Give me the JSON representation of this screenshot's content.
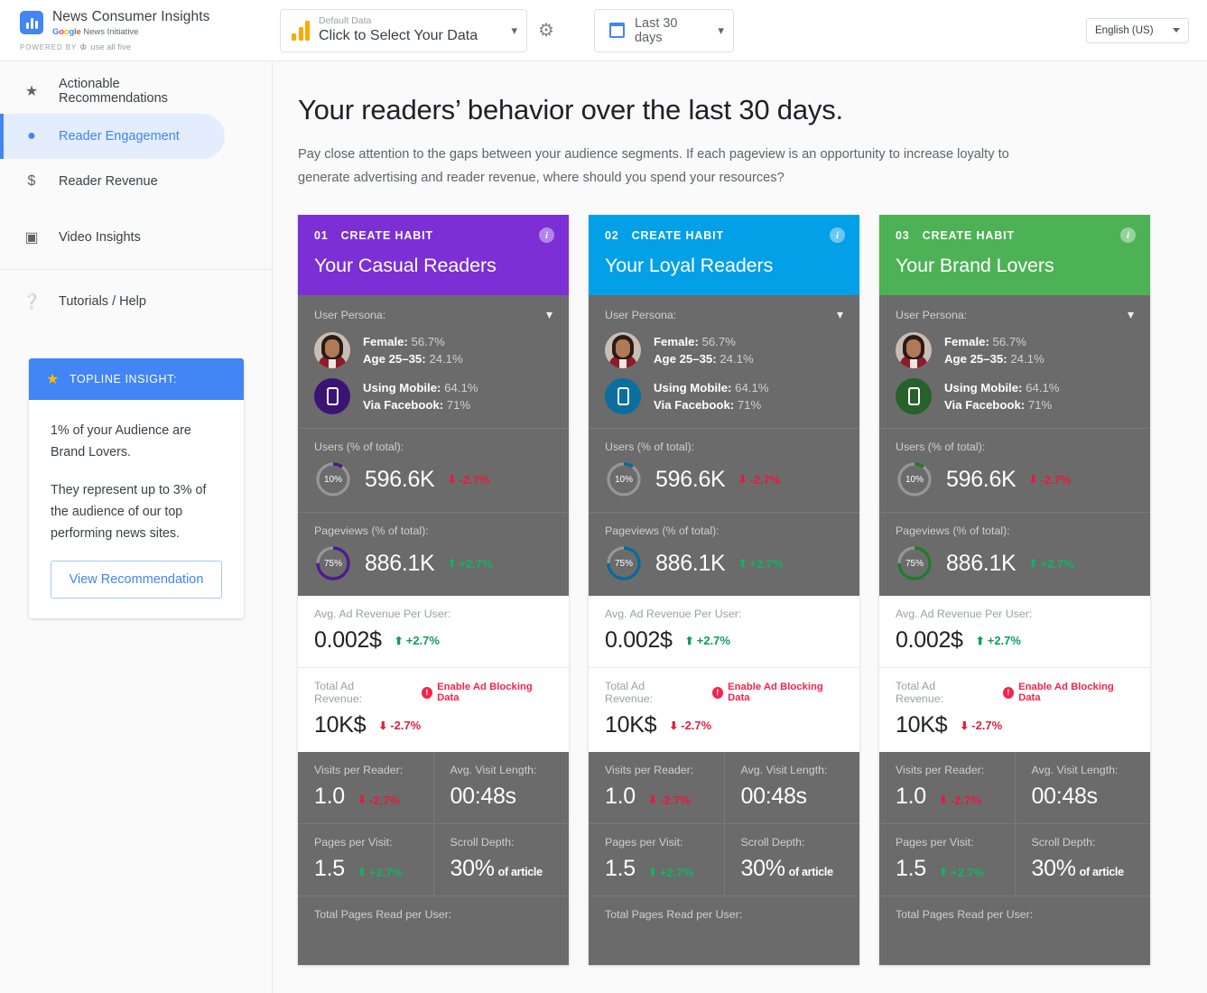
{
  "topbar": {
    "brand_title": "News Consumer Insights",
    "brand_sub_google": "Google",
    "brand_sub_rest": "News Initiative",
    "powered_by": "POWERED BY",
    "powered_by_name": "use all five",
    "data_select_label": "Default Data",
    "data_select_value": "Click to Select Your Data",
    "gear_icon": "gear-icon",
    "date_value": "Last 30 days",
    "language": "English (US)"
  },
  "sidebar": {
    "items": [
      {
        "label": "Actionable Recommendations",
        "icon": "star-icon"
      },
      {
        "label": "Reader Engagement",
        "icon": "person-icon"
      },
      {
        "label": "Reader Revenue",
        "icon": "dollar-icon"
      },
      {
        "label": "Video Insights",
        "icon": "video-icon"
      },
      {
        "label": "Tutorials / Help",
        "icon": "help-icon"
      }
    ],
    "insight": {
      "header": "TOPLINE INSIGHT:",
      "star_icon": "star-icon",
      "paragraph1": "1% of your Audience are Brand Lovers.",
      "paragraph2": "They represent up to 3% of the audience of our top performing news sites.",
      "button": "View Recommendation"
    }
  },
  "main": {
    "title": "Your readers’ behavior over the last 30 days.",
    "subtitle": "Pay close attention to the gaps between your audience segments. If each pageview is an opportunity to increase loyalty to generate advertising and reader revenue, where should you spend your resources?"
  },
  "labels": {
    "persona": "User Persona:",
    "users": "Users (% of total):",
    "pageviews": "Pageviews (% of total):",
    "avg_ad_rev": "Avg. Ad Revenue Per User:",
    "total_ad_rev": "Total Ad Revenue:",
    "visits_per_reader": "Visits per Reader:",
    "avg_visit_length": "Avg. Visit Length:",
    "pages_per_visit": "Pages per Visit:",
    "scroll_depth": "Scroll Depth:",
    "total_pages_read": "Total Pages Read per User:",
    "enable_ad_blocking": "Enable Ad Blocking Data",
    "female": "Female:",
    "age": "Age 25–35:",
    "using_mobile": "Using Mobile:",
    "via_facebook": "Via Facebook:",
    "of_article": "of article",
    "habit": "CREATE HABIT"
  },
  "cards": [
    {
      "number": "01",
      "kicker": "CREATE HABIT",
      "title": "Your Casual Readers",
      "color": "#7b2fd4",
      "donut_color": "#4b1c8c",
      "mobile_bg": "#3b1373",
      "persona": {
        "female": "56.7%",
        "age": "24.1%",
        "mobile": "64.1%",
        "facebook": "71%"
      },
      "users": {
        "pct": "10%",
        "pct_value": 10,
        "value": "596.6K",
        "delta": "-2.7%",
        "dir": "down"
      },
      "pageviews": {
        "pct": "75%",
        "pct_value": 75,
        "value": "886.1K",
        "delta": "+2.7%",
        "dir": "up"
      },
      "avg_ad_revenue": {
        "value": "0.002$",
        "delta": "+2.7%",
        "dir": "up"
      },
      "total_ad_revenue": {
        "value": "10K$",
        "delta": "-2.7%",
        "dir": "down"
      },
      "visits_per_reader": {
        "value": "1.0",
        "delta": "-2.7%",
        "dir": "down"
      },
      "avg_visit_length": {
        "value": "00:48s"
      },
      "pages_per_visit": {
        "value": "1.5",
        "delta": "+2.7%",
        "dir": "up"
      },
      "scroll_depth": {
        "value": "30%"
      }
    },
    {
      "number": "02",
      "kicker": "CREATE HABIT",
      "title": "Your Loyal Readers",
      "color": "#03a0e8",
      "donut_color": "#0a6a96",
      "mobile_bg": "#0a6f9e",
      "persona": {
        "female": "56.7%",
        "age": "24.1%",
        "mobile": "64.1%",
        "facebook": "71%"
      },
      "users": {
        "pct": "10%",
        "pct_value": 10,
        "value": "596.6K",
        "delta": "-2.7%",
        "dir": "down"
      },
      "pageviews": {
        "pct": "75%",
        "pct_value": 75,
        "value": "886.1K",
        "delta": "+2.7%",
        "dir": "up"
      },
      "avg_ad_revenue": {
        "value": "0.002$",
        "delta": "+2.7%",
        "dir": "up"
      },
      "total_ad_revenue": {
        "value": "10K$",
        "delta": "-2.7%",
        "dir": "down"
      },
      "visits_per_reader": {
        "value": "1.0",
        "delta": "-2.7%",
        "dir": "down"
      },
      "avg_visit_length": {
        "value": "00:48s"
      },
      "pages_per_visit": {
        "value": "1.5",
        "delta": "+2.7%",
        "dir": "up"
      },
      "scroll_depth": {
        "value": "30%"
      }
    },
    {
      "number": "03",
      "kicker": "CREATE HABIT",
      "title": "Your Brand Lovers",
      "color": "#4cb255",
      "donut_color": "#237a2c",
      "mobile_bg": "#27612c",
      "persona": {
        "female": "56.7%",
        "age": "24.1%",
        "mobile": "64.1%",
        "facebook": "71%"
      },
      "users": {
        "pct": "10%",
        "pct_value": 10,
        "value": "596.6K",
        "delta": "-2.7%",
        "dir": "down"
      },
      "pageviews": {
        "pct": "75%",
        "pct_value": 75,
        "value": "886.1K",
        "delta": "+2.7%",
        "dir": "up"
      },
      "avg_ad_revenue": {
        "value": "0.002$",
        "delta": "+2.7%",
        "dir": "up"
      },
      "total_ad_revenue": {
        "value": "10K$",
        "delta": "-2.7%",
        "dir": "down"
      },
      "visits_per_reader": {
        "value": "1.0",
        "delta": "-2.7%",
        "dir": "down"
      },
      "avg_visit_length": {
        "value": "00:48s"
      },
      "pages_per_visit": {
        "value": "1.5",
        "delta": "+2.7%",
        "dir": "up"
      },
      "scroll_depth": {
        "value": "30%"
      }
    }
  ]
}
